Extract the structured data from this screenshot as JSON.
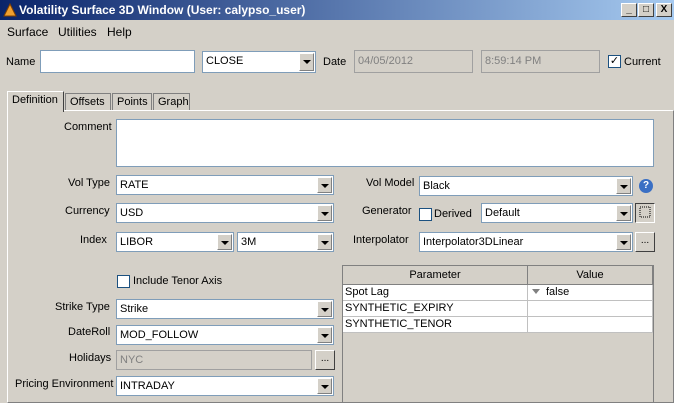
{
  "window": {
    "title": "Volatility Surface 3D Window (User: calypso_user)"
  },
  "menu": {
    "items": [
      "Surface",
      "Utilities",
      "Help"
    ]
  },
  "header": {
    "name_label": "Name",
    "name_value": "",
    "close_combo": "CLOSE",
    "date_label": "Date",
    "date_value": "04/05/2012",
    "time_value": "8:59:14 PM",
    "current_label": "Current",
    "current_checked": "✓"
  },
  "tabs": [
    "Definition",
    "Offsets",
    "Points",
    "Graph"
  ],
  "definition": {
    "comment_label": "Comment",
    "comment_value": "",
    "vol_type_label": "Vol Type",
    "vol_type": "RATE",
    "currency_label": "Currency",
    "currency": "USD",
    "index_label": "Index",
    "index": "LIBOR",
    "tenor": "3M",
    "include_tenor_label": "Include Tenor Axis",
    "strike_type_label": "Strike Type",
    "strike_type": "Strike",
    "dateroll_label": "DateRoll",
    "dateroll": "MOD_FOLLOW",
    "holidays_label": "Holidays",
    "holidays": "NYC",
    "pricing_env_label": "Pricing Environment",
    "pricing_env": "INTRADAY",
    "vol_model_label": "Vol Model",
    "vol_model": "Black",
    "generator_label": "Generator",
    "derived_label": "Derived",
    "generator": "Default",
    "interpolator_label": "Interpolator",
    "interpolator": "Interpolator3DLinear",
    "ellipsis": "...",
    "help": "?"
  },
  "params_table": {
    "headers": [
      "Parameter",
      "Value"
    ],
    "rows": [
      {
        "parameter": "Spot Lag",
        "value": "false"
      },
      {
        "parameter": "SYNTHETIC_EXPIRY",
        "value": ""
      },
      {
        "parameter": "SYNTHETIC_TENOR",
        "value": ""
      }
    ]
  },
  "window_buttons": {
    "minimize": "_",
    "maximize": "□",
    "close": "X"
  }
}
